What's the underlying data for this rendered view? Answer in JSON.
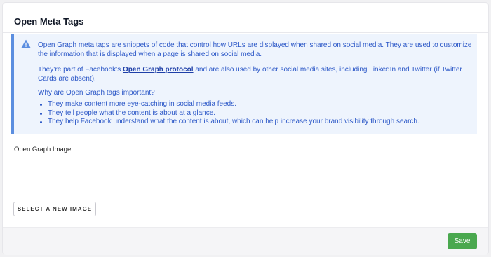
{
  "panel": {
    "title": "Open Meta Tags"
  },
  "notice": {
    "paragraph1": "Open Graph meta tags are snippets of code that control how URLs are displayed when shared on social media. They are used to customize the information that is displayed when a page is shared on social media.",
    "paragraph2_before": "They’re part of Facebook’s ",
    "paragraph2_link": "Open Graph protocol",
    "paragraph2_after": " and are also used by other social media sites, including LinkedIn and Twitter (if Twitter Cards are absent).",
    "question": "Why are Open Graph tags important?",
    "bullets": [
      "They make content more eye-catching in social media feeds.",
      "They tell people what the content is about at a glance.",
      "They help Facebook understand what the content is about, which can help increase your brand visibility through search."
    ],
    "icon": "warning-icon",
    "color": "#2b57c7"
  },
  "image_field": {
    "label": "Open Graph Image",
    "button_label": "SELECT A NEW IMAGE"
  },
  "footer": {
    "save_label": "Save",
    "save_color": "#4aa84f"
  }
}
